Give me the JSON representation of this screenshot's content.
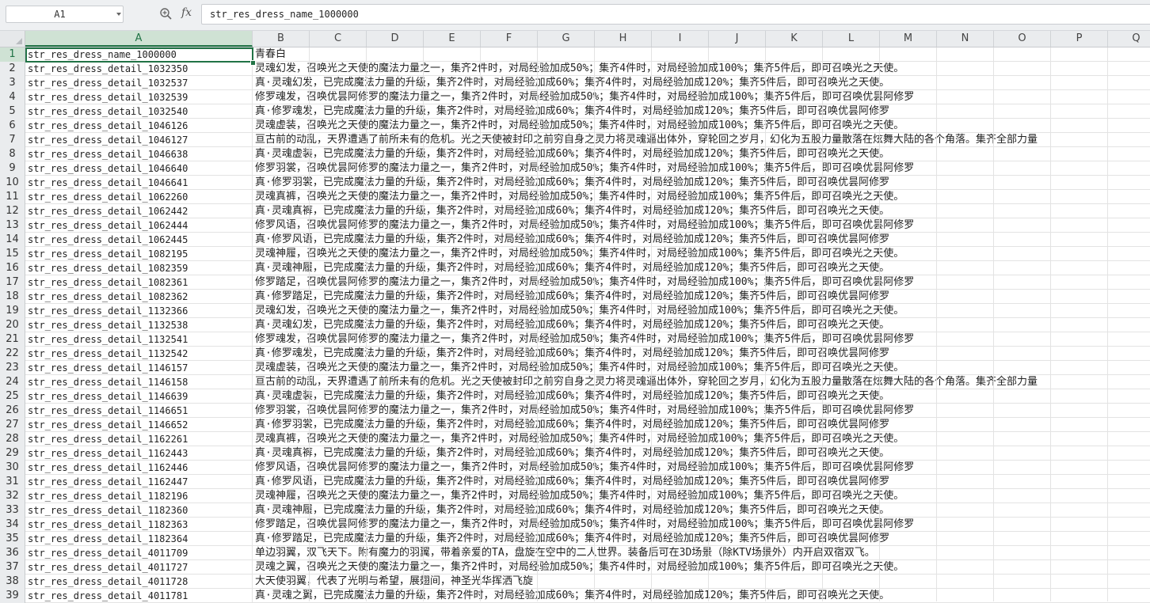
{
  "formula_bar": {
    "name_box": "A1",
    "fx_label": "fx",
    "formula_value": "str_res_dress_name_1000000"
  },
  "columns": [
    "A",
    "B",
    "C",
    "D",
    "E",
    "F",
    "G",
    "H",
    "I",
    "J",
    "K",
    "L",
    "M",
    "N",
    "O",
    "P",
    "Q"
  ],
  "selected_cell": "A1",
  "rows": [
    {
      "n": "1",
      "a": "str_res_dress_name_1000000",
      "b": "青春白"
    },
    {
      "n": "2",
      "a": "str_res_dress_detail_1032350",
      "b": "灵魂幻发，召唤光之天使的魔法力量之一，集齐2件时，对局经验加成50%；集齐4件时，对局经验加成100%；集齐5件后，即可召唤光之天使。"
    },
    {
      "n": "3",
      "a": "str_res_dress_detail_1032537",
      "b": "真·灵魂幻发，已完成魔法力量的升级，集齐2件时，对局经验加成60%；集齐4件时，对局经验加成120%；集齐5件后，即可召唤光之天使。"
    },
    {
      "n": "4",
      "a": "str_res_dress_detail_1032539",
      "b": "修罗魂发，召唤优昙阿修罗的魔法力量之一，集齐2件时，对局经验加成50%；集齐4件时，对局经验加成100%；集齐5件后，即可召唤优昙阿修罗"
    },
    {
      "n": "5",
      "a": "str_res_dress_detail_1032540",
      "b": "真·修罗魂发，已完成魔法力量的升级，集齐2件时，对局经验加成60%；集齐4件时，对局经验加成120%；集齐5件后，即可召唤优昙阿修罗"
    },
    {
      "n": "6",
      "a": "str_res_dress_detail_1046126",
      "b": "灵魂虚装，召唤光之天使的魔法力量之一，集齐2件时，对局经验加成50%；集齐4件时，对局经验加成100%；集齐5件后，即可召唤光之天使。"
    },
    {
      "n": "7",
      "a": "str_res_dress_detail_1046127",
      "b": "亘古前的动乱，天界遭遇了前所未有的危机。光之天使被封印之前穷自身之灵力将灵魂逼出体外，穿轮回之岁月，幻化为五股力量散落在炫舞大陆的各个角落。集齐全部力量"
    },
    {
      "n": "8",
      "a": "str_res_dress_detail_1046638",
      "b": "真·灵魂虚装，已完成魔法力量的升级，集齐2件时，对局经验加成60%；集齐4件时，对局经验加成120%；集齐5件后，即可召唤光之天使。"
    },
    {
      "n": "9",
      "a": "str_res_dress_detail_1046640",
      "b": "修罗羽裳，召唤优昙阿修罗的魔法力量之一，集齐2件时，对局经验加成50%；集齐4件时，对局经验加成100%；集齐5件后，即可召唤优昙阿修罗"
    },
    {
      "n": "10",
      "a": "str_res_dress_detail_1046641",
      "b": "真·修罗羽裳，已完成魔法力量的升级，集齐2件时，对局经验加成60%；集齐4件时，对局经验加成120%；集齐5件后，即可召唤优昙阿修罗"
    },
    {
      "n": "11",
      "a": "str_res_dress_detail_1062260",
      "b": "灵魂真裤，召唤光之天使的魔法力量之一，集齐2件时，对局经验加成50%；集齐4件时，对局经验加成100%；集齐5件后，即可召唤光之天使。"
    },
    {
      "n": "12",
      "a": "str_res_dress_detail_1062442",
      "b": "真·灵魂真裤，已完成魔法力量的升级，集齐2件时，对局经验加成60%；集齐4件时，对局经验加成120%；集齐5件后，即可召唤光之天使。"
    },
    {
      "n": "13",
      "a": "str_res_dress_detail_1062444",
      "b": "修罗风语，召唤优昙阿修罗的魔法力量之一，集齐2件时，对局经验加成50%；集齐4件时，对局经验加成100%；集齐5件后，即可召唤优昙阿修罗"
    },
    {
      "n": "14",
      "a": "str_res_dress_detail_1062445",
      "b": "真·修罗风语，已完成魔法力量的升级，集齐2件时，对局经验加成60%；集齐4件时，对局经验加成120%；集齐5件后，即可召唤优昙阿修罗"
    },
    {
      "n": "15",
      "a": "str_res_dress_detail_1082195",
      "b": "灵魂神履，召唤光之天使的魔法力量之一，集齐2件时，对局经验加成50%；集齐4件时，对局经验加成100%；集齐5件后，即可召唤光之天使。"
    },
    {
      "n": "16",
      "a": "str_res_dress_detail_1082359",
      "b": "真·灵魂神履，已完成魔法力量的升级，集齐2件时，对局经验加成60%；集齐4件时，对局经验加成120%；集齐5件后，即可召唤光之天使。"
    },
    {
      "n": "17",
      "a": "str_res_dress_detail_1082361",
      "b": "修罗踏足，召唤优昙阿修罗的魔法力量之一，集齐2件时，对局经验加成50%；集齐4件时，对局经验加成100%；集齐5件后，即可召唤优昙阿修罗"
    },
    {
      "n": "18",
      "a": "str_res_dress_detail_1082362",
      "b": "真·修罗踏足，已完成魔法力量的升级，集齐2件时，对局经验加成60%；集齐4件时，对局经验加成120%；集齐5件后，即可召唤优昙阿修罗"
    },
    {
      "n": "19",
      "a": "str_res_dress_detail_1132366",
      "b": "灵魂幻发，召唤光之天使的魔法力量之一，集齐2件时，对局经验加成50%；集齐4件时，对局经验加成100%；集齐5件后，即可召唤光之天使。"
    },
    {
      "n": "20",
      "a": "str_res_dress_detail_1132538",
      "b": "真·灵魂幻发，已完成魔法力量的升级，集齐2件时，对局经验加成60%；集齐4件时，对局经验加成120%；集齐5件后，即可召唤光之天使。"
    },
    {
      "n": "21",
      "a": "str_res_dress_detail_1132541",
      "b": "修罗魂发，召唤优昙阿修罗的魔法力量之一，集齐2件时，对局经验加成50%；集齐4件时，对局经验加成100%；集齐5件后，即可召唤优昙阿修罗"
    },
    {
      "n": "22",
      "a": "str_res_dress_detail_1132542",
      "b": "真·修罗魂发，已完成魔法力量的升级，集齐2件时，对局经验加成60%；集齐4件时，对局经验加成120%；集齐5件后，即可召唤优昙阿修罗"
    },
    {
      "n": "23",
      "a": "str_res_dress_detail_1146157",
      "b": "灵魂虚装，召唤光之天使的魔法力量之一，集齐2件时，对局经验加成50%；集齐4件时，对局经验加成100%；集齐5件后，即可召唤光之天使。"
    },
    {
      "n": "24",
      "a": "str_res_dress_detail_1146158",
      "b": "亘古前的动乱，天界遭遇了前所未有的危机。光之天使被封印之前穷自身之灵力将灵魂逼出体外，穿轮回之岁月，幻化为五股力量散落在炫舞大陆的各个角落。集齐全部力量"
    },
    {
      "n": "25",
      "a": "str_res_dress_detail_1146639",
      "b": "真·灵魂虚装，已完成魔法力量的升级，集齐2件时，对局经验加成60%；集齐4件时，对局经验加成120%；集齐5件后，即可召唤光之天使。"
    },
    {
      "n": "26",
      "a": "str_res_dress_detail_1146651",
      "b": "修罗羽裳，召唤优昙阿修罗的魔法力量之一，集齐2件时，对局经验加成50%；集齐4件时，对局经验加成100%；集齐5件后，即可召唤优昙阿修罗"
    },
    {
      "n": "27",
      "a": "str_res_dress_detail_1146652",
      "b": "真·修罗羽裳，已完成魔法力量的升级，集齐2件时，对局经验加成60%；集齐4件时，对局经验加成120%；集齐5件后，即可召唤优昙阿修罗"
    },
    {
      "n": "28",
      "a": "str_res_dress_detail_1162261",
      "b": "灵魂真裤，召唤光之天使的魔法力量之一，集齐2件时，对局经验加成50%；集齐4件时，对局经验加成100%；集齐5件后，即可召唤光之天使。"
    },
    {
      "n": "29",
      "a": "str_res_dress_detail_1162443",
      "b": "真·灵魂真裤，已完成魔法力量的升级，集齐2件时，对局经验加成60%；集齐4件时，对局经验加成120%；集齐5件后，即可召唤光之天使。"
    },
    {
      "n": "30",
      "a": "str_res_dress_detail_1162446",
      "b": "修罗风语，召唤优昙阿修罗的魔法力量之一，集齐2件时，对局经验加成50%；集齐4件时，对局经验加成100%；集齐5件后，即可召唤优昙阿修罗"
    },
    {
      "n": "31",
      "a": "str_res_dress_detail_1162447",
      "b": "真·修罗风语，已完成魔法力量的升级，集齐2件时，对局经验加成60%；集齐4件时，对局经验加成120%；集齐5件后，即可召唤优昙阿修罗"
    },
    {
      "n": "32",
      "a": "str_res_dress_detail_1182196",
      "b": "灵魂神履，召唤光之天使的魔法力量之一，集齐2件时，对局经验加成50%；集齐4件时，对局经验加成100%；集齐5件后，即可召唤光之天使。"
    },
    {
      "n": "33",
      "a": "str_res_dress_detail_1182360",
      "b": "真·灵魂神履，已完成魔法力量的升级，集齐2件时，对局经验加成60%；集齐4件时，对局经验加成120%；集齐5件后，即可召唤光之天使。"
    },
    {
      "n": "34",
      "a": "str_res_dress_detail_1182363",
      "b": "修罗踏足，召唤优昙阿修罗的魔法力量之一，集齐2件时，对局经验加成50%；集齐4件时，对局经验加成100%；集齐5件后，即可召唤优昙阿修罗"
    },
    {
      "n": "35",
      "a": "str_res_dress_detail_1182364",
      "b": "真·修罗踏足，已完成魔法力量的升级，集齐2件时，对局经验加成60%；集齐4件时，对局经验加成120%；集齐5件后，即可召唤优昙阿修罗"
    },
    {
      "n": "36",
      "a": "str_res_dress_detail_4011709",
      "b": "单边羽翼，双飞天下。附有魔力的羽翼，带着亲爱的TA，盘旋在空中的二人世界。装备后可在3D场景（除KTV场景外）内开启双宿双飞。"
    },
    {
      "n": "37",
      "a": "str_res_dress_detail_4011727",
      "b": "灵魂之翼，召唤光之天使的魔法力量之一，集齐2件时，对局经验加成50%；集齐4件时，对局经验加成100%；集齐5件后，即可召唤光之天使。"
    },
    {
      "n": "38",
      "a": "str_res_dress_detail_4011728",
      "b": "大天使羽翼，代表了光明与希望，展翅间，神圣光华挥洒飞旋"
    },
    {
      "n": "39",
      "a": "str_res_dress_detail_4011781",
      "b": "真·灵魂之翼，已完成魔法力量的升级，集齐2件时，对局经验加成60%；集齐4件时，对局经验加成120%；集齐5件后，即可召唤光之天使。"
    }
  ]
}
